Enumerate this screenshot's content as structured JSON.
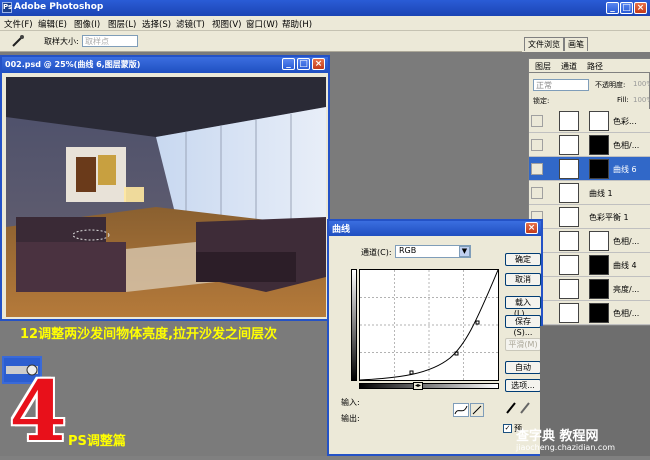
{
  "app": {
    "title": "Adobe Photoshop"
  },
  "menu": [
    "文件(F)",
    "编辑(E)",
    "图像(I)",
    "图层(L)",
    "选择(S)",
    "滤镜(T)",
    "视图(V)",
    "窗口(W)",
    "帮助(H)"
  ],
  "options": {
    "sample_label": "取样大小:",
    "sample_value": "取样点"
  },
  "panel_tabs": [
    "文件浏览",
    "画笔"
  ],
  "layers_panel": {
    "tabs": [
      "图层",
      "通道",
      "路径"
    ],
    "blend_mode": "正常",
    "opacity_label": "不透明度:",
    "opacity_value": "100%",
    "lock_label": "锁定:",
    "fill_label": "Fill:",
    "fill_value": "100%",
    "layers": [
      {
        "name": "色彩..."
      },
      {
        "name": "色相/..."
      },
      {
        "name": "曲线 6"
      },
      {
        "name": "曲线 1"
      },
      {
        "name": "色彩平衡 1"
      },
      {
        "name": "色相/..."
      },
      {
        "name": "曲线 4"
      },
      {
        "name": "亮度/..."
      },
      {
        "name": "色相/..."
      }
    ]
  },
  "document": {
    "title": "002.psd @ 25%(曲线 6,图层蒙版)"
  },
  "curves": {
    "title": "曲线",
    "channel_label": "通道(C):",
    "channel_value": "RGB",
    "buttons": {
      "ok": "确定",
      "cancel": "取消",
      "load": "载入(L)...",
      "save": "保存(S)...",
      "smooth": "平滑(M)",
      "auto": "自动",
      "options": "选项..."
    },
    "input_label": "输入:",
    "output_label": "输出:",
    "preview_label": "预"
  },
  "annotations": {
    "caption": "12调整两沙发间物体亮度,拉开沙发之间层次",
    "number": "4",
    "section": "PS调整篇"
  },
  "watermark": {
    "line1": "查字典 教程网",
    "line2": "jiaocheng.chazidian.com"
  }
}
